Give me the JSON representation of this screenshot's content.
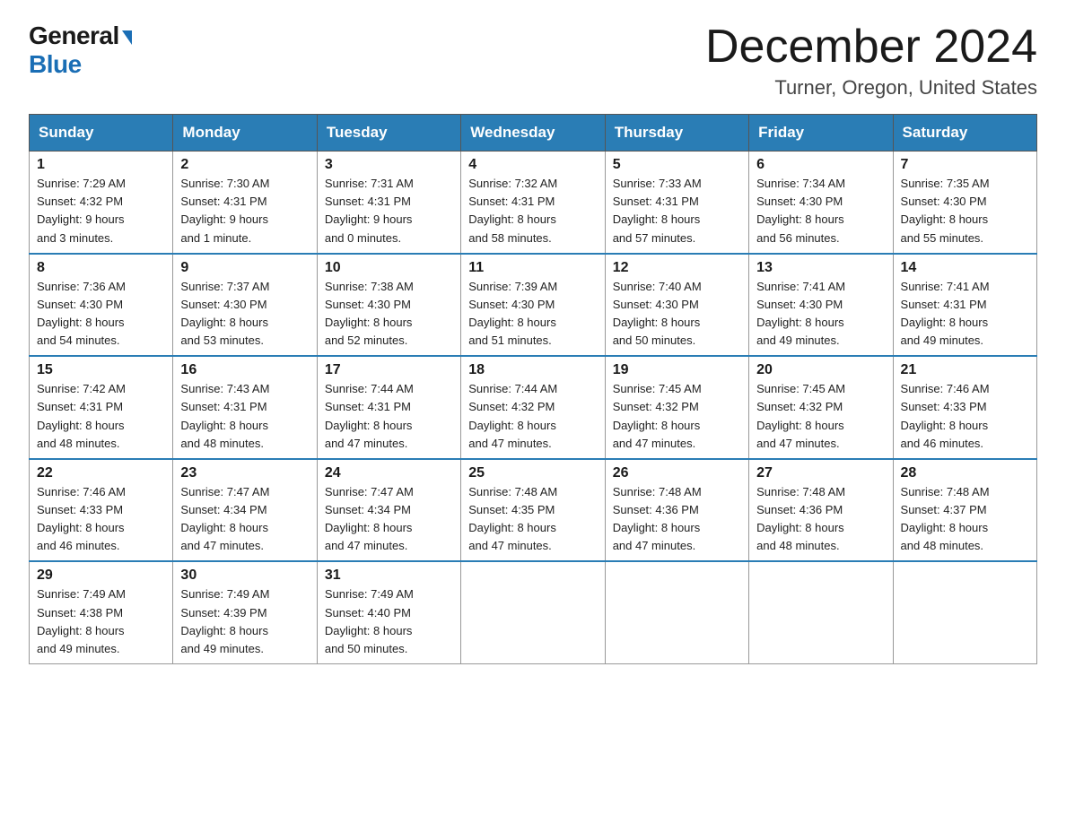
{
  "logo": {
    "general": "General",
    "blue": "Blue",
    "triangle": "▶"
  },
  "title": "December 2024",
  "location": "Turner, Oregon, United States",
  "days_of_week": [
    "Sunday",
    "Monday",
    "Tuesday",
    "Wednesday",
    "Thursday",
    "Friday",
    "Saturday"
  ],
  "weeks": [
    [
      {
        "day": "1",
        "sunrise": "7:29 AM",
        "sunset": "4:32 PM",
        "daylight": "9 hours and 3 minutes."
      },
      {
        "day": "2",
        "sunrise": "7:30 AM",
        "sunset": "4:31 PM",
        "daylight": "9 hours and 1 minute."
      },
      {
        "day": "3",
        "sunrise": "7:31 AM",
        "sunset": "4:31 PM",
        "daylight": "9 hours and 0 minutes."
      },
      {
        "day": "4",
        "sunrise": "7:32 AM",
        "sunset": "4:31 PM",
        "daylight": "8 hours and 58 minutes."
      },
      {
        "day": "5",
        "sunrise": "7:33 AM",
        "sunset": "4:31 PM",
        "daylight": "8 hours and 57 minutes."
      },
      {
        "day": "6",
        "sunrise": "7:34 AM",
        "sunset": "4:30 PM",
        "daylight": "8 hours and 56 minutes."
      },
      {
        "day": "7",
        "sunrise": "7:35 AM",
        "sunset": "4:30 PM",
        "daylight": "8 hours and 55 minutes."
      }
    ],
    [
      {
        "day": "8",
        "sunrise": "7:36 AM",
        "sunset": "4:30 PM",
        "daylight": "8 hours and 54 minutes."
      },
      {
        "day": "9",
        "sunrise": "7:37 AM",
        "sunset": "4:30 PM",
        "daylight": "8 hours and 53 minutes."
      },
      {
        "day": "10",
        "sunrise": "7:38 AM",
        "sunset": "4:30 PM",
        "daylight": "8 hours and 52 minutes."
      },
      {
        "day": "11",
        "sunrise": "7:39 AM",
        "sunset": "4:30 PM",
        "daylight": "8 hours and 51 minutes."
      },
      {
        "day": "12",
        "sunrise": "7:40 AM",
        "sunset": "4:30 PM",
        "daylight": "8 hours and 50 minutes."
      },
      {
        "day": "13",
        "sunrise": "7:41 AM",
        "sunset": "4:30 PM",
        "daylight": "8 hours and 49 minutes."
      },
      {
        "day": "14",
        "sunrise": "7:41 AM",
        "sunset": "4:31 PM",
        "daylight": "8 hours and 49 minutes."
      }
    ],
    [
      {
        "day": "15",
        "sunrise": "7:42 AM",
        "sunset": "4:31 PM",
        "daylight": "8 hours and 48 minutes."
      },
      {
        "day": "16",
        "sunrise": "7:43 AM",
        "sunset": "4:31 PM",
        "daylight": "8 hours and 48 minutes."
      },
      {
        "day": "17",
        "sunrise": "7:44 AM",
        "sunset": "4:31 PM",
        "daylight": "8 hours and 47 minutes."
      },
      {
        "day": "18",
        "sunrise": "7:44 AM",
        "sunset": "4:32 PM",
        "daylight": "8 hours and 47 minutes."
      },
      {
        "day": "19",
        "sunrise": "7:45 AM",
        "sunset": "4:32 PM",
        "daylight": "8 hours and 47 minutes."
      },
      {
        "day": "20",
        "sunrise": "7:45 AM",
        "sunset": "4:32 PM",
        "daylight": "8 hours and 47 minutes."
      },
      {
        "day": "21",
        "sunrise": "7:46 AM",
        "sunset": "4:33 PM",
        "daylight": "8 hours and 46 minutes."
      }
    ],
    [
      {
        "day": "22",
        "sunrise": "7:46 AM",
        "sunset": "4:33 PM",
        "daylight": "8 hours and 46 minutes."
      },
      {
        "day": "23",
        "sunrise": "7:47 AM",
        "sunset": "4:34 PM",
        "daylight": "8 hours and 47 minutes."
      },
      {
        "day": "24",
        "sunrise": "7:47 AM",
        "sunset": "4:34 PM",
        "daylight": "8 hours and 47 minutes."
      },
      {
        "day": "25",
        "sunrise": "7:48 AM",
        "sunset": "4:35 PM",
        "daylight": "8 hours and 47 minutes."
      },
      {
        "day": "26",
        "sunrise": "7:48 AM",
        "sunset": "4:36 PM",
        "daylight": "8 hours and 47 minutes."
      },
      {
        "day": "27",
        "sunrise": "7:48 AM",
        "sunset": "4:36 PM",
        "daylight": "8 hours and 48 minutes."
      },
      {
        "day": "28",
        "sunrise": "7:48 AM",
        "sunset": "4:37 PM",
        "daylight": "8 hours and 48 minutes."
      }
    ],
    [
      {
        "day": "29",
        "sunrise": "7:49 AM",
        "sunset": "4:38 PM",
        "daylight": "8 hours and 49 minutes."
      },
      {
        "day": "30",
        "sunrise": "7:49 AM",
        "sunset": "4:39 PM",
        "daylight": "8 hours and 49 minutes."
      },
      {
        "day": "31",
        "sunrise": "7:49 AM",
        "sunset": "4:40 PM",
        "daylight": "8 hours and 50 minutes."
      },
      null,
      null,
      null,
      null
    ]
  ],
  "labels": {
    "sunrise": "Sunrise:",
    "sunset": "Sunset:",
    "daylight": "Daylight:"
  }
}
